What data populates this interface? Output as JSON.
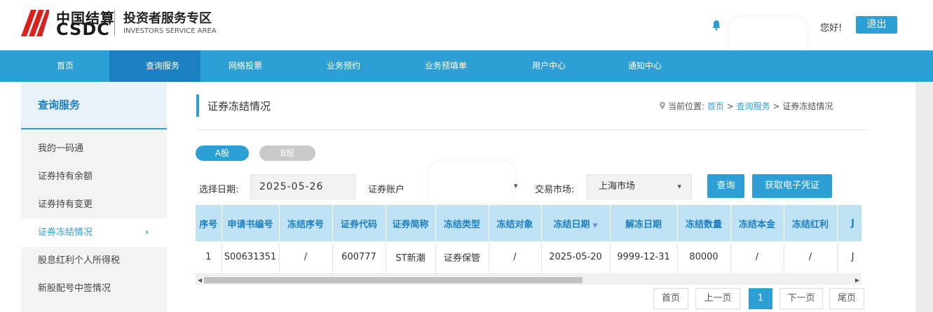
{
  "header": {
    "logo_cn": "中国结算",
    "logo_en": "CSDC",
    "area_cn": "投资者服务专区",
    "area_en": "INVESTORS SERVICE AREA",
    "greeting": "您好!",
    "logout": "退出"
  },
  "nav": [
    "首页",
    "查询服务",
    "网络投票",
    "业务预约",
    "业务预填单",
    "用户中心",
    "通知中心"
  ],
  "nav_active_index": 1,
  "sidebar": {
    "title": "查询服务",
    "items": [
      {
        "label": "我的一码通"
      },
      {
        "label": "证券持有余额"
      },
      {
        "label": "证券持有变更"
      },
      {
        "label": "证券冻结情况",
        "active": true,
        "chevron": "›"
      },
      {
        "label": "股息红利个人所得税"
      },
      {
        "label": "新股配号中签情况"
      }
    ]
  },
  "page": {
    "title": "证券冻结情况",
    "breadcrumb_prefix": "当前位置:",
    "breadcrumb": [
      "首页",
      "查询服务",
      "证券冻结情况"
    ],
    "separator": ">"
  },
  "tabs": [
    {
      "label": "A股",
      "active": true
    },
    {
      "label": "B股",
      "active": false
    }
  ],
  "filters": {
    "date_label": "选择日期:",
    "date_value": "2025-05-26",
    "account_label": "证券账户",
    "market_label": "交易市场:",
    "market_value": "上海市场",
    "query_button": "查询",
    "cert_button": "获取电子凭证"
  },
  "table": {
    "columns": [
      "序号",
      "申请书编号",
      "冻结序号",
      "证券代码",
      "证券简称",
      "冻结类型",
      "冻结对象",
      "冻结日期",
      "解冻日期",
      "冻结数量",
      "冻结本金",
      "冻结红利",
      "J"
    ],
    "sort_column_index": 7,
    "rows": [
      [
        "1",
        "S00631351",
        "/",
        "600777",
        "ST新潮",
        "证券保管",
        "/",
        "2025-05-20",
        "9999-12-31",
        "80000",
        "/",
        "/",
        "J"
      ]
    ]
  },
  "pagination": {
    "first": "首页",
    "prev": "上一页",
    "current": "1",
    "next": "下一页",
    "last": "尾页"
  },
  "colors": {
    "primary": "#2d9fd5",
    "nav_active": "#1c7fc0",
    "table_header": "#bfe3f4",
    "logo_red": "#d7221f"
  }
}
